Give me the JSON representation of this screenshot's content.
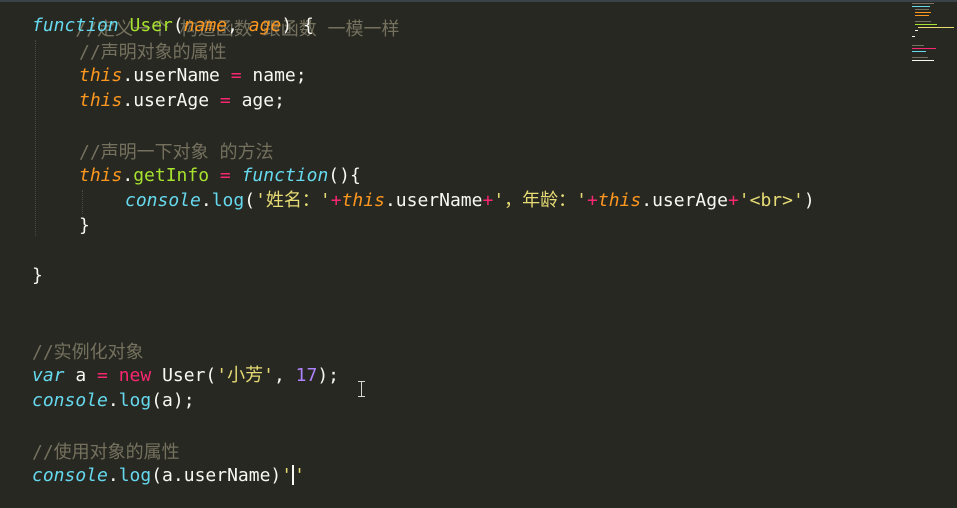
{
  "editor": {
    "theme_colors": {
      "background": "#272822",
      "keyword": "#66d9ef",
      "function_name": "#a6e22e",
      "parameter": "#fd971f",
      "operator": "#f92672",
      "string": "#e6db74",
      "number": "#ae81ff",
      "comment": "#75715e",
      "text": "#f8f8f2"
    },
    "lines": {
      "l0": {
        "comment": "//定义一个 构造函数 跟函数 一模一样"
      },
      "l1": {
        "kw_function": "function",
        "name": "User",
        "open": "(",
        "p1": "name",
        "sep": ", ",
        "p2": "age",
        "close": ") {"
      },
      "l2": {
        "comment": "//声明对象的属性"
      },
      "l3": {
        "this": "this",
        "prop": ".userName ",
        "eq": "=",
        "val": " name;"
      },
      "l4": {
        "this": "this",
        "prop": ".userAge ",
        "eq": "=",
        "val": " age;"
      },
      "l5": {
        "comment": "//声明一下对象 的方法"
      },
      "l6": {
        "this": "this",
        "dot": ".",
        "method": "getInfo",
        "eq_pre": " ",
        "eq": "=",
        "eq_post": " ",
        "kw_function": "function",
        "rest": "(){"
      },
      "l7": {
        "console": "console",
        "dot": ".",
        "log": "log",
        "open": "(",
        "s1": "'姓名：'",
        "plus1": "+",
        "this1": "this",
        "prop1": ".userName",
        "plus2": "+",
        "s2": "'，年龄：'",
        "plus3": "+",
        "this2": "this",
        "prop2": ".userAge",
        "plus4": "+",
        "s3": "'<br>'",
        "close": ")"
      },
      "l8": {
        "brace": "}"
      },
      "l9": {
        "brace": "}"
      },
      "l10": {
        "comment": "//实例化对象"
      },
      "l11": {
        "kw_var": "var",
        "id": " a ",
        "eq": "=",
        "sp": " ",
        "kw_new": "new",
        "call": " User(",
        "s": "'小芳'",
        "sep": ", ",
        "num": "17",
        "end": ");"
      },
      "l12": {
        "console": "console",
        "dot": ".",
        "log": "log",
        "rest": "(a);"
      },
      "l13": {
        "comment": "//使用对象的属性"
      },
      "l14": {
        "console": "console",
        "dot": ".",
        "log": "log",
        "rest": "(a.userName)",
        "q1": "'",
        "q2": "'"
      }
    }
  }
}
